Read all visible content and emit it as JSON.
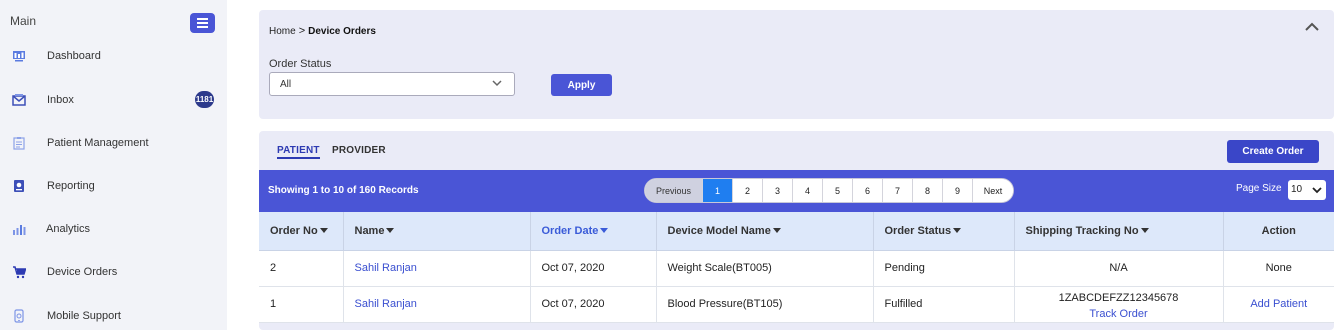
{
  "sidebar": {
    "header": "Main",
    "toggle_icon": "hamburger-icon",
    "items": [
      {
        "label": "Dashboard",
        "icon": "dashboard-icon"
      },
      {
        "label": "Inbox",
        "icon": "inbox-icon",
        "badge": "1181"
      },
      {
        "label": "Patient Management",
        "icon": "clipboard-icon"
      },
      {
        "label": "Reporting",
        "icon": "report-icon"
      },
      {
        "label": "Analytics",
        "icon": "bar-chart-icon"
      },
      {
        "label": "Device Orders",
        "icon": "cart-icon"
      },
      {
        "label": "Mobile Support",
        "icon": "mobile-icon"
      }
    ]
  },
  "breadcrumb": {
    "home": "Home",
    "separator": ">",
    "current": "Device Orders"
  },
  "filter": {
    "status_label": "Order Status",
    "status_value": "All",
    "apply_label": "Apply"
  },
  "tabs": [
    {
      "label": "PATIENT",
      "active": true
    },
    {
      "label": "PROVIDER",
      "active": false
    }
  ],
  "create_order_label": "Create Order",
  "records_text": "Showing 1 to 10 of 160 Records",
  "pagination": {
    "previous": "Previous",
    "pages": [
      "1",
      "2",
      "3",
      "4",
      "5",
      "6",
      "7",
      "8",
      "9"
    ],
    "active_page": "1",
    "next": "Next"
  },
  "page_size": {
    "label": "Page Size",
    "value": "10"
  },
  "table": {
    "columns": [
      "Order No",
      "Name",
      "Order Date",
      "Device Model Name",
      "Order Status",
      "Shipping Tracking No",
      "Action"
    ],
    "sorted_column": "Order Date",
    "rows": [
      {
        "order_no": "2",
        "name": "Sahil Ranjan",
        "order_date": "Oct 07, 2020",
        "device": "Weight Scale(BT005)",
        "status": "Pending",
        "tracking": "N/A",
        "tracking_link": "",
        "action": "None"
      },
      {
        "order_no": "1",
        "name": "Sahil Ranjan",
        "order_date": "Oct 07, 2020",
        "device": "Blood Pressure(BT105)",
        "status": "Fulfilled",
        "tracking": "1ZABCDEFZZ12345678",
        "tracking_link": "Track Order",
        "action": "Add Patient"
      }
    ]
  },
  "colors": {
    "accent": "#4a55d6",
    "active_page": "#1f7ef0",
    "header_row": "#dde8fa",
    "link": "#3a4fd0"
  }
}
